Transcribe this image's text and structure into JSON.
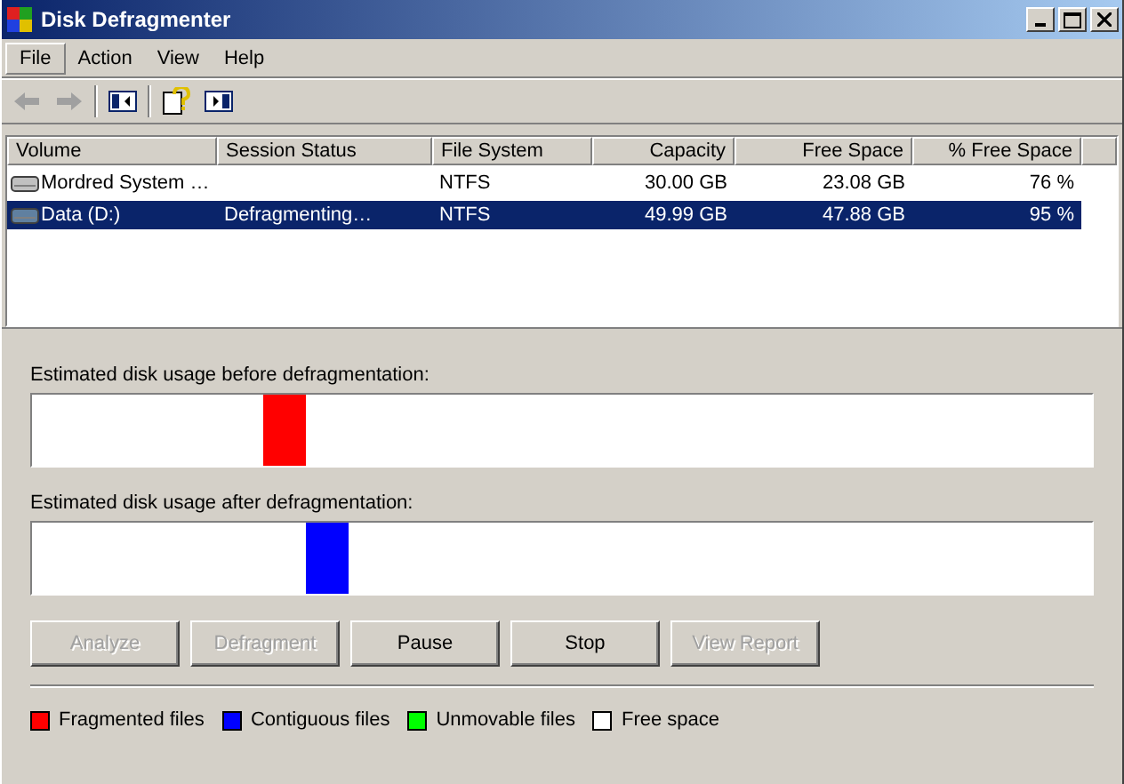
{
  "window": {
    "title": "Disk Defragmenter"
  },
  "menu": [
    {
      "label": "File",
      "selected": true
    },
    {
      "label": "Action",
      "selected": false
    },
    {
      "label": "View",
      "selected": false
    },
    {
      "label": "Help",
      "selected": false
    }
  ],
  "toolbar": [
    {
      "kind": "back",
      "disabled": true
    },
    {
      "kind": "forward",
      "disabled": true
    },
    {
      "kind": "sep"
    },
    {
      "kind": "console-tree"
    },
    {
      "kind": "sep"
    },
    {
      "kind": "help"
    },
    {
      "kind": "action-pane"
    }
  ],
  "table": {
    "columns": [
      "Volume",
      "Session Status",
      "File System",
      "Capacity",
      "Free Space",
      "% Free Space"
    ],
    "rows": [
      {
        "selected": false,
        "cells": [
          "Mordred System …",
          "",
          "NTFS",
          "30.00 GB",
          "23.08 GB",
          "76 %"
        ]
      },
      {
        "selected": true,
        "cells": [
          "Data (D:)",
          "Defragmenting…",
          "NTFS",
          "49.99 GB",
          "47.88 GB",
          "95 %"
        ]
      }
    ]
  },
  "maps": [
    {
      "label": "Estimated disk usage before defragmentation:",
      "color": "#ff0000"
    },
    {
      "label": "Estimated disk usage after defragmentation:",
      "color": "#0000ff"
    }
  ],
  "buttons": [
    {
      "label": "Analyze",
      "disabled": true
    },
    {
      "label": "Defragment",
      "disabled": true
    },
    {
      "label": "Pause",
      "disabled": false
    },
    {
      "label": "Stop",
      "disabled": false
    },
    {
      "label": "View Report",
      "disabled": true
    }
  ],
  "legend": [
    {
      "label": "Fragmented files",
      "color": "#ff0000"
    },
    {
      "label": "Contiguous files",
      "color": "#0000ff"
    },
    {
      "label": "Unmovable files",
      "color": "#00ff00"
    },
    {
      "label": "Free space",
      "color": "#ffffff"
    }
  ]
}
